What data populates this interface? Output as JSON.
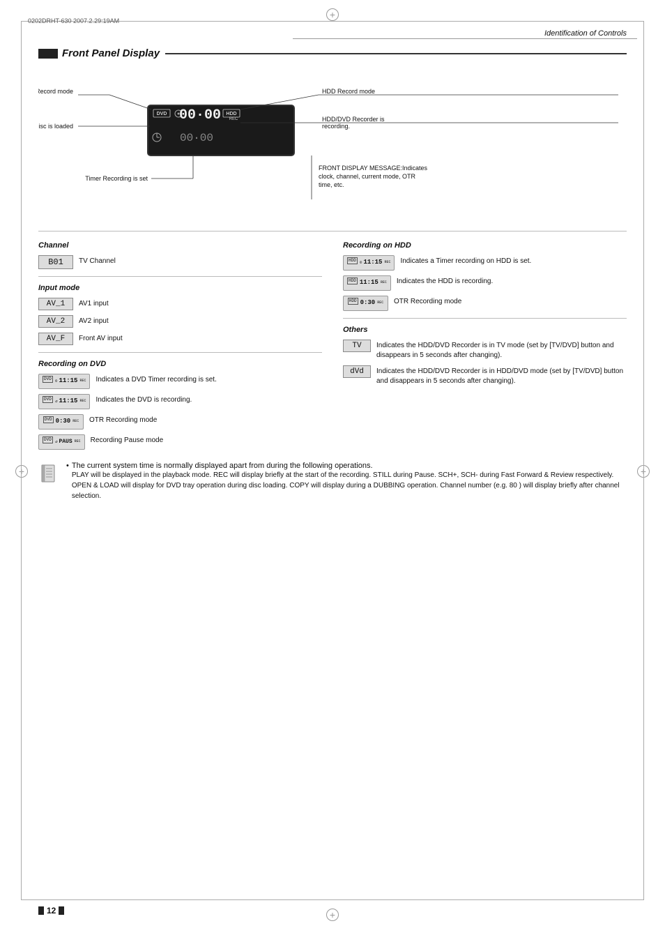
{
  "page": {
    "file_info": "0202DRHT-630 2007.2.29:19AM",
    "page_number": "12",
    "header_title": "Identification of Controls"
  },
  "section": {
    "title": "Front Panel Display"
  },
  "diagram": {
    "dvd_record_mode_label": "DVD Record mode",
    "hdd_record_mode_label": "HDD Record mode",
    "disc_loaded_label": "Disc is loaded",
    "hdd_dvd_recorder_label": "HDD/DVD Recorder is recording.",
    "timer_recording_label": "Timer Recording is set",
    "front_display_label": "FRONT DISPLAY MESSAGE:Indicates clock, channel, current mode, OTR time, etc.",
    "display_top_time": "00:00",
    "display_bottom_time": "00:00",
    "dvd_label": "DVD",
    "hdd_label": "HDD",
    "rec_label": "REC"
  },
  "channel": {
    "title": "Channel",
    "box_value": "B01",
    "desc": "TV Channel"
  },
  "input_mode": {
    "title": "Input mode",
    "items": [
      {
        "box": "AV_1",
        "desc": "AV1 input"
      },
      {
        "box": "AV_2",
        "desc": "AV2 input"
      },
      {
        "box": "AV_F",
        "desc": "Front AV input"
      }
    ]
  },
  "recording_dvd": {
    "title": "Recording on DVD",
    "items": [
      {
        "icon_text": "11:15",
        "sup_text": "DVD",
        "sub_text": "REC",
        "has_circle": true,
        "desc": "Indicates a DVD Timer recording is set."
      },
      {
        "icon_text": "11:15",
        "sup_text": "DVD",
        "sub_text": "REC",
        "has_circle": true,
        "desc": "Indicates the DVD is recording."
      },
      {
        "icon_text": "0:30",
        "sup_text": "DVD",
        "sub_text": "REC",
        "has_circle": false,
        "desc": "OTR Recording mode"
      },
      {
        "icon_text": "PAUS",
        "sup_text": "DVD",
        "sub_text": "REC",
        "has_circle": true,
        "desc": "Recording Pause mode"
      }
    ]
  },
  "recording_hdd": {
    "title": "Recording on HDD",
    "items": [
      {
        "icon_text": "11:15",
        "sup_text": "HDD",
        "sub_text": "REC",
        "has_circle": true,
        "desc": "Indicates a Timer recording on HDD is set."
      },
      {
        "icon_text": "11:15",
        "sup_text": "HDD",
        "sub_text": "REC",
        "has_circle": false,
        "desc": "Indicates the HDD is recording."
      },
      {
        "icon_text": "0:30",
        "sup_text": "HDD",
        "sub_text": "REC",
        "has_circle": false,
        "desc": "OTR Recording mode"
      }
    ]
  },
  "others": {
    "title": "Others",
    "items": [
      {
        "box_text": "TV",
        "desc": "Indicates the HDD/DVD Recorder is in TV mode (set by [TV/DVD] button and disappears in 5 seconds after changing)."
      },
      {
        "box_text": "dVd",
        "desc": "Indicates the HDD/DVD Recorder is in HDD/DVD mode (set by [TV/DVD] button and disappears in 5 seconds after changing)."
      }
    ]
  },
  "note": {
    "bullet": "The current system time is normally displayed apart from during the following operations.",
    "body": "PLAY will be displayed in the playback mode. REC will display briefly at the start of the recording. STILL during Pause. SCH+, SCH- during Fast Forward & Review respectively. OPEN & LOAD will display for DVD tray operation during disc loading. COPY will display during a DUBBING operation. Channel number (e.g. 80 ) will display briefly after channel selection."
  }
}
